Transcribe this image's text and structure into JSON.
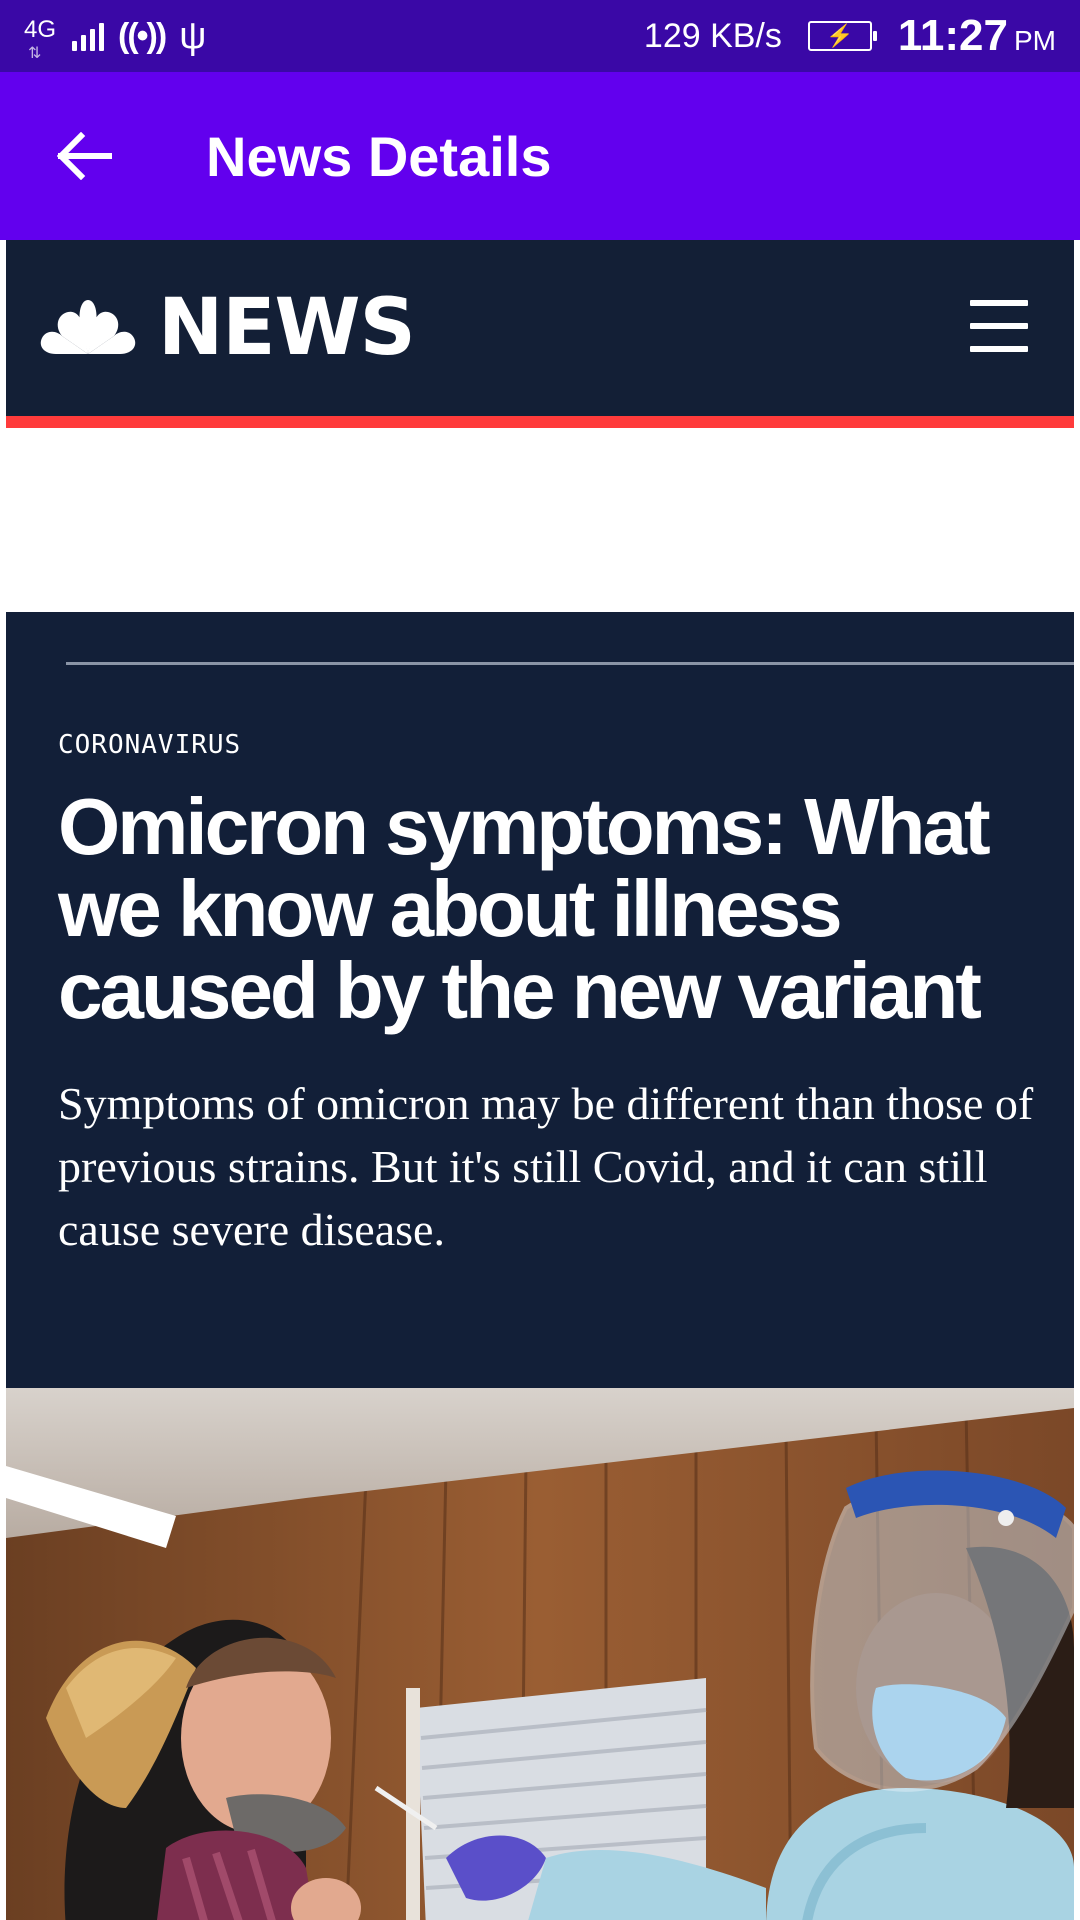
{
  "status_bar": {
    "network": "4G",
    "speed": "129 KB/s",
    "time": "11:27",
    "ampm": "PM",
    "icons": [
      "network-arrows-icon",
      "signal-icon",
      "hotspot-icon",
      "usb-icon",
      "battery-charging-icon"
    ]
  },
  "app_bar": {
    "title": "News Details",
    "back_icon": "arrow-back-icon"
  },
  "site": {
    "brand": "NEWS",
    "logo_icon": "peacock-icon",
    "menu_icon": "hamburger-menu-icon",
    "accent_color": "#ff3b3b",
    "header_color": "#131f36"
  },
  "article": {
    "kicker": "CORONAVIRUS",
    "headline": "Omicron symptoms: What we know about illness caused by the new variant",
    "dek": "Symptoms of omicron may be different than those of previous strains. But it's still Covid, and it can still cause severe disease."
  },
  "colors": {
    "status_bar": "#3a08a6",
    "app_bar": "#6200ee",
    "page_bg": "#121f38"
  }
}
